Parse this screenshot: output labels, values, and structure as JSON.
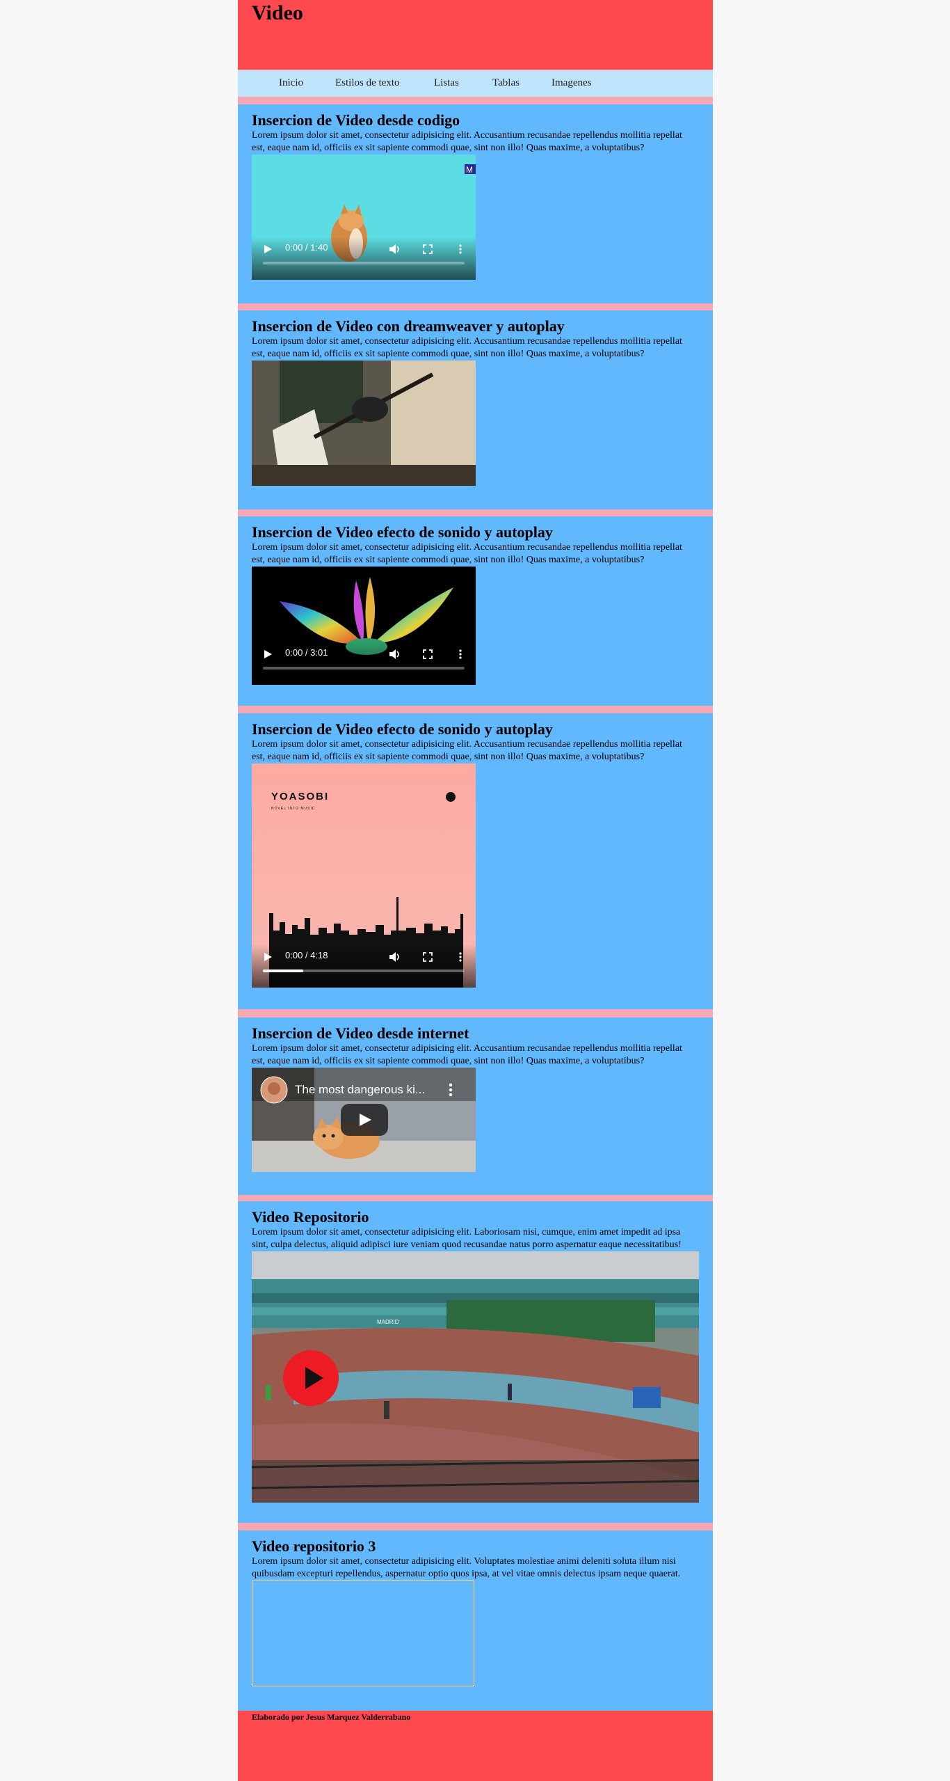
{
  "header": {
    "title": "Video"
  },
  "nav": {
    "items": [
      "Inicio",
      "Estilos de texto",
      "Listas",
      "Tablas",
      "Imagenes"
    ]
  },
  "sections": [
    {
      "title": "Insercion de Video desde codigo",
      "text": "Lorem ipsum dolor sit amet, consectetur adipisicing elit. Accusantium recusandae repellendus mollitia repellat est, eaque nam id, officiis ex sit sapiente commodi quae, sint non illo! Quas maxime, a voluptatibus?",
      "video": {
        "time": "0:00 / 1:40",
        "progress": 0.0
      }
    },
    {
      "title": "Insercion de Video con dreamweaver y autoplay",
      "text": "Lorem ipsum dolor sit amet, consectetur adipisicing elit. Accusantium recusandae repellendus mollitia repellat est, eaque nam id, officiis ex sit sapiente commodi quae, sint non illo! Quas maxime, a voluptatibus?"
    },
    {
      "title": "Insercion de Video efecto de sonido y autoplay",
      "text": "Lorem ipsum dolor sit amet, consectetur adipisicing elit. Accusantium recusandae repellendus mollitia repellat est, eaque nam id, officiis ex sit sapiente commodi quae, sint non illo! Quas maxime, a voluptatibus?",
      "video": {
        "time": "0:00 / 3:01",
        "progress": 0.0
      }
    },
    {
      "title": "Insercion de Video efecto de sonido y autoplay",
      "text": "Lorem ipsum dolor sit amet, consectetur adipisicing elit. Accusantium recusandae repellendus mollitia repellat est, eaque nam id, officiis ex sit sapiente commodi quae, sint non illo! Quas maxime, a voluptatibus?",
      "video": {
        "time": "0:00 / 4:18",
        "progress": 0.2
      },
      "poster": {
        "brand": "YOASOBI",
        "subtitle": "NOVEL INTO MUSIC"
      }
    },
    {
      "title": "Insercion de Video desde internet",
      "text": "Lorem ipsum dolor sit amet, consectetur adipisicing elit. Accusantium recusandae repellendus mollitia repellat est, eaque nam id, officiis ex sit sapiente commodi quae, sint non illo! Quas maxime, a voluptatibus?",
      "embed": {
        "title": "The most dangerous ki..."
      }
    },
    {
      "title": "Video Repositorio",
      "text": "Lorem ipsum dolor sit amet, consectetur adipisicing elit. Laboriosam nisi, cumque, enim amet impedit ad ipsa sint, culpa delectus, aliquid adipisci iure veniam quod recusandae natus porro aspernatur eaque necessitatibus!",
      "banner": "MADRID"
    },
    {
      "title": "Video repositorio 3",
      "text": "Lorem ipsum dolor sit amet, consectetur adipisicing elit. Voluptates molestiae animi deleniti soluta illum nisi quibusdam excepturi repellendus, aspernatur optio quos ipsa, at vel vitae omnis delectus ipsam neque quaerat."
    }
  ],
  "footer": {
    "text": "Elaborado por Jesus Marquez Valderrabano"
  },
  "colors": {
    "header": "#fe4a4f",
    "nav": "#bfe5fd",
    "section": "#62b8fd",
    "separator": "#f7a7b4",
    "youtube_red": "#ff0000"
  }
}
